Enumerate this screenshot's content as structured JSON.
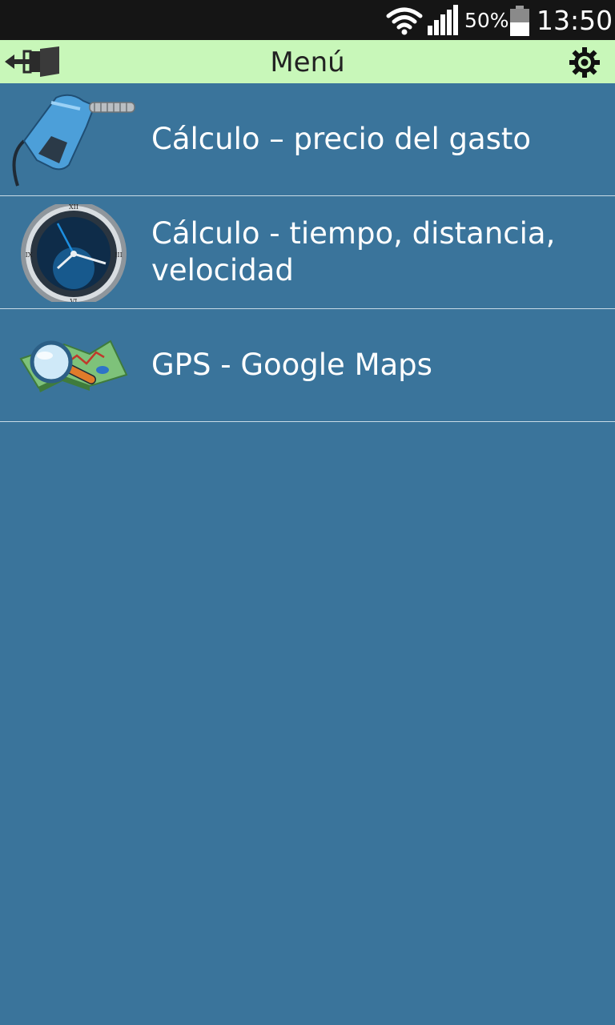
{
  "status_bar": {
    "battery_percent": "50%",
    "time": "13:50",
    "icons": [
      "wifi-icon",
      "signal-icon",
      "battery-icon"
    ]
  },
  "app_bar": {
    "title": "Menú",
    "back_icon": "exit-icon",
    "settings_icon": "gear-icon"
  },
  "menu": {
    "items": [
      {
        "label": "Cálculo – precio del gasto",
        "icon": "fuel-nozzle-icon"
      },
      {
        "label": "Cálculo - tiempo, distancia, velocidad",
        "icon": "clock-icon"
      },
      {
        "label": "GPS - Google Maps",
        "icon": "map-magnifier-icon"
      }
    ]
  },
  "colors": {
    "background": "#3a749b",
    "app_bar": "#c8f7b9",
    "status_bar": "#151515",
    "divider": "#c9dbe6",
    "text": "#ffffff"
  }
}
